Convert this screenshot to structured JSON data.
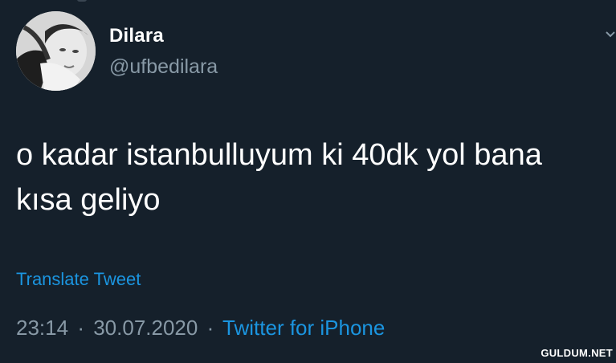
{
  "user": {
    "display_name": "Dilara",
    "handle": "@ufbedilara"
  },
  "tweet": {
    "text": "o kadar istanbulluyum ki 40dk yol bana\nkısa geliyo",
    "translate_label": "Translate Tweet",
    "time": "23:14",
    "date": "30.07.2020",
    "separator": "·",
    "source": "Twitter for iPhone"
  },
  "watermark": "GULDUM.NET",
  "colors": {
    "background": "#15202b",
    "text": "#ffffff",
    "muted": "#8899a6",
    "link": "#1b95e0"
  },
  "icons": {
    "avatar": "profile-photo",
    "menu": "chevron-down-icon"
  }
}
